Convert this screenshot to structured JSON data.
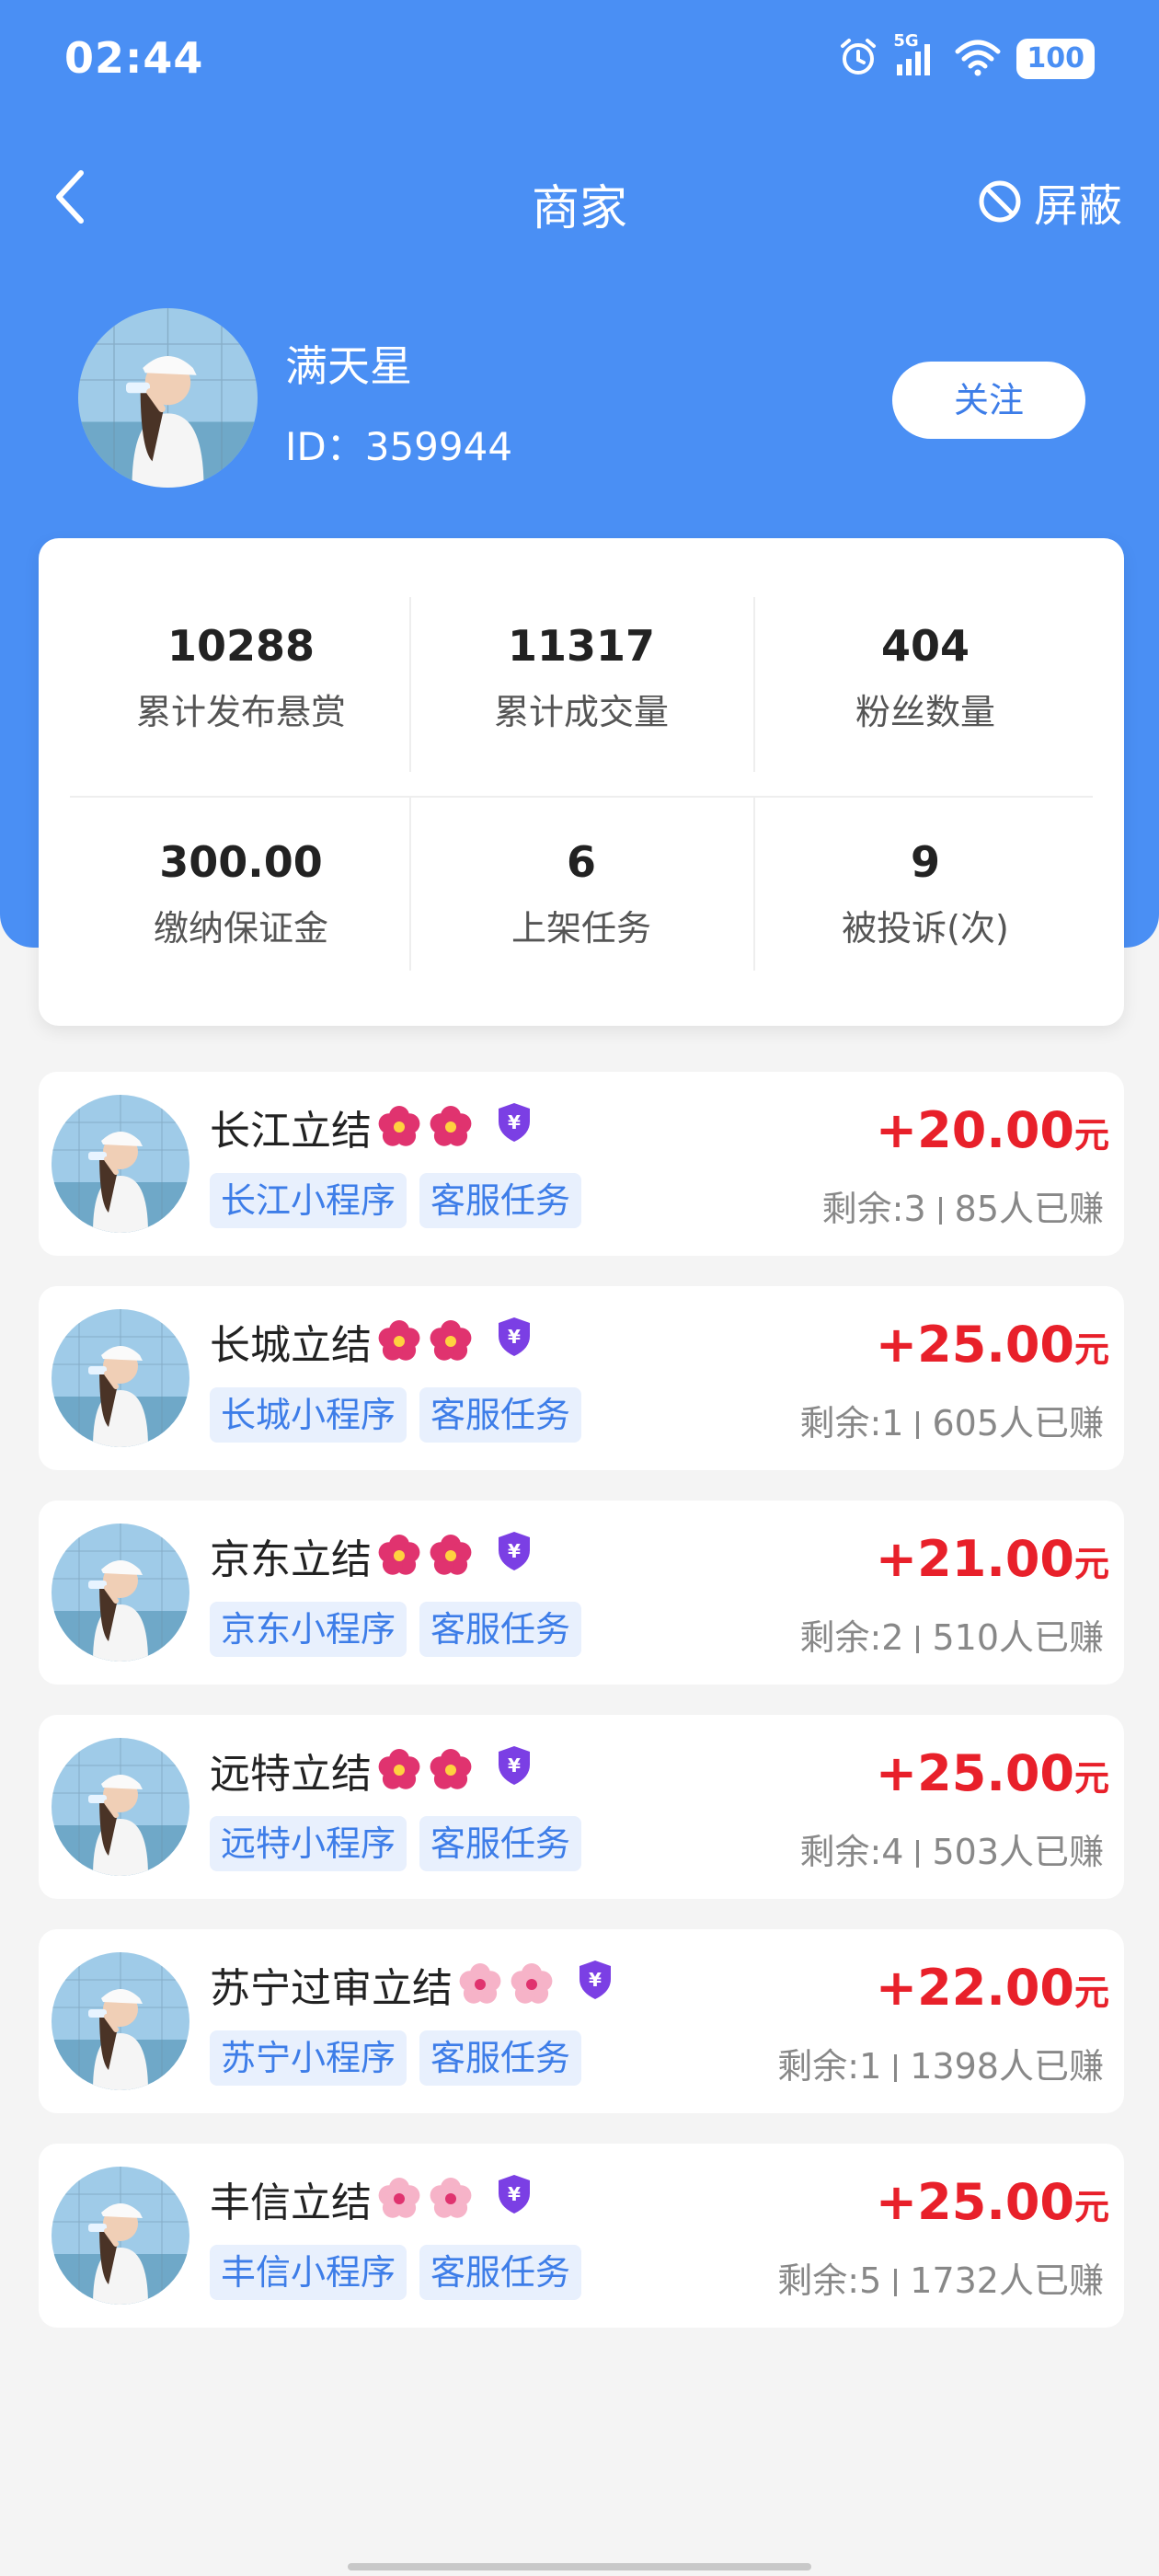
{
  "status_bar": {
    "time": "02:44",
    "network": "5G",
    "battery": "100"
  },
  "nav": {
    "title": "商家",
    "block_label": "屏蔽"
  },
  "profile": {
    "name": "满天星",
    "id_text": "ID：359944",
    "follow_label": "关注"
  },
  "stats": [
    {
      "value": "10288",
      "label": "累计发布悬赏"
    },
    {
      "value": "11317",
      "label": "累计成交量"
    },
    {
      "value": "404",
      "label": "粉丝数量"
    },
    {
      "value": "300.00",
      "label": "缴纳保证金"
    },
    {
      "value": "6",
      "label": "上架任务"
    },
    {
      "value": "9",
      "label": "被投诉(次)"
    }
  ],
  "tasks": [
    {
      "title": "长江立结",
      "flower": "hibiscus",
      "tags": [
        "长江小程序",
        "客服任务"
      ],
      "price": "+20.00",
      "unit": "元",
      "remaining": "剩余:3",
      "earned": "85人已赚"
    },
    {
      "title": "长城立结",
      "flower": "hibiscus",
      "tags": [
        "长城小程序",
        "客服任务"
      ],
      "price": "+25.00",
      "unit": "元",
      "remaining": "剩余:1",
      "earned": "605人已赚"
    },
    {
      "title": "京东立结",
      "flower": "hibiscus",
      "tags": [
        "京东小程序",
        "客服任务"
      ],
      "price": "+21.00",
      "unit": "元",
      "remaining": "剩余:2",
      "earned": "510人已赚"
    },
    {
      "title": "远特立结",
      "flower": "hibiscus",
      "tags": [
        "远特小程序",
        "客服任务"
      ],
      "price": "+25.00",
      "unit": "元",
      "remaining": "剩余:4",
      "earned": "503人已赚"
    },
    {
      "title": "苏宁过审立结",
      "flower": "cherry-blossom",
      "tags": [
        "苏宁小程序",
        "客服任务"
      ],
      "price": "+22.00",
      "unit": "元",
      "remaining": "剩余:1",
      "earned": "1398人已赚"
    },
    {
      "title": "丰信立结",
      "flower": "cherry-blossom",
      "tags": [
        "丰信小程序",
        "客服任务"
      ],
      "price": "+25.00",
      "unit": "元",
      "remaining": "剩余:5",
      "earned": "1732人已赚"
    }
  ],
  "colors": {
    "primary": "#4a8ff4",
    "price": "#e8202a",
    "tag_bg": "#e8f0fd",
    "tag_text": "#3d7de8",
    "badge": "#7b3fe4"
  }
}
